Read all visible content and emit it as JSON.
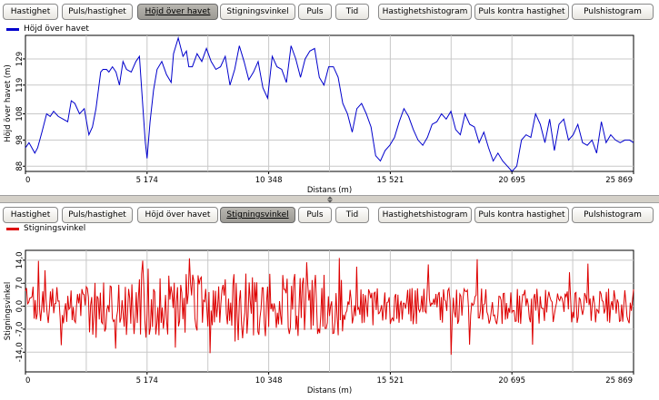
{
  "tabs": [
    {
      "id": "hastighet",
      "label": "Hastighet"
    },
    {
      "id": "puls-hastighet",
      "label": "Puls/hastighet"
    },
    {
      "id": "hojd",
      "label": "Höjd över havet"
    },
    {
      "id": "stigningsvinkel",
      "label": "Stigningsvinkel"
    },
    {
      "id": "puls",
      "label": "Puls"
    },
    {
      "id": "tid",
      "label": "Tid"
    },
    {
      "id": "hastighetshistogram",
      "label": "Hastighetshistogram"
    },
    {
      "id": "puls-kontra-hastighet",
      "label": "Puls kontra hastighet"
    },
    {
      "id": "pulshistogram",
      "label": "Pulshistogram"
    }
  ],
  "top_panel": {
    "active_tab": "hojd",
    "legend_label": "Höjd över havet",
    "line_color": "#0000cc"
  },
  "bottom_panel": {
    "active_tab": "stigningsvinkel",
    "legend_label": "Stigningsvinkel",
    "line_color": "#dd0000"
  },
  "chart_data": [
    {
      "type": "line",
      "title": "",
      "series_name": "Höjd över havet",
      "xlabel": "Distans (m)",
      "ylabel": "Höjd över havet (m)",
      "xlim": [
        0,
        25869
      ],
      "ylim": [
        86,
        138
      ],
      "x_ticks": [
        0,
        5174,
        10348,
        15521,
        20695,
        25869
      ],
      "x_tick_labels": [
        "0",
        "5 174",
        "10 348",
        "15 521",
        "20 695",
        "25 869"
      ],
      "y_ticks": [
        88,
        98,
        108,
        119,
        129
      ],
      "y_tick_labels": [
        "88",
        "98",
        "108",
        "119",
        "129"
      ],
      "grid": true,
      "legend": "top-left",
      "color": "#0000cc",
      "x": [
        0,
        150,
        400,
        520,
        700,
        900,
        1050,
        1200,
        1400,
        1600,
        1800,
        1950,
        2100,
        2300,
        2500,
        2700,
        2850,
        3000,
        3200,
        3300,
        3450,
        3550,
        3700,
        3850,
        4000,
        4150,
        4300,
        4500,
        4700,
        4850,
        5000,
        5100,
        5174,
        5300,
        5450,
        5600,
        5800,
        6000,
        6200,
        6300,
        6500,
        6700,
        6850,
        6950,
        7100,
        7300,
        7500,
        7700,
        7900,
        8100,
        8300,
        8500,
        8700,
        8900,
        9100,
        9300,
        9500,
        9700,
        9900,
        10100,
        10300,
        10500,
        10700,
        10900,
        11100,
        11300,
        11500,
        11700,
        11900,
        12100,
        12300,
        12500,
        12700,
        12900,
        13100,
        13300,
        13500,
        13700,
        13900,
        14100,
        14300,
        14500,
        14700,
        14900,
        15100,
        15300,
        15500,
        15700,
        15900,
        16100,
        16300,
        16500,
        16700,
        16900,
        17100,
        17300,
        17500,
        17700,
        17900,
        18100,
        18300,
        18500,
        18700,
        18900,
        19100,
        19300,
        19500,
        19700,
        19900,
        20100,
        20300,
        20500,
        20700,
        20900,
        21100,
        21300,
        21500,
        21700,
        21900,
        22100,
        22300,
        22500,
        22700,
        22900,
        23100,
        23300,
        23500,
        23700,
        23900,
        24100,
        24300,
        24500,
        24700,
        24900,
        25100,
        25300,
        25500,
        25700,
        25869
      ],
      "y": [
        95,
        97,
        93,
        95,
        101,
        108,
        107,
        109,
        107,
        106,
        105,
        113,
        112,
        108,
        110,
        100,
        103,
        110,
        124,
        125,
        125,
        124,
        126,
        124,
        119,
        128,
        125,
        124,
        128,
        130,
        110,
        97,
        91,
        105,
        117,
        125,
        128,
        123,
        120,
        131,
        137,
        130,
        132,
        126,
        126,
        131,
        128,
        133,
        128,
        125,
        126,
        130,
        119,
        125,
        134,
        128,
        121,
        124,
        128,
        118,
        114,
        130,
        126,
        125,
        120,
        134,
        129,
        122,
        129,
        132,
        133,
        122,
        119,
        126,
        126,
        122,
        112,
        108,
        101,
        110,
        112,
        108,
        103,
        92,
        90,
        94,
        96,
        99,
        105,
        110,
        107,
        102,
        98,
        96,
        99,
        104,
        105,
        108,
        106,
        109,
        102,
        100,
        108,
        104,
        103,
        97,
        101,
        95,
        90,
        93,
        90,
        88,
        86,
        88,
        98,
        100,
        99,
        108,
        104,
        97,
        106,
        94,
        104,
        106,
        98,
        100,
        104,
        97,
        96,
        98,
        93,
        105,
        97,
        100,
        98,
        97,
        98,
        98,
        97
      ]
    },
    {
      "type": "line",
      "title": "",
      "series_name": "Stigningsvinkel",
      "xlabel": "Distans (m)",
      "ylabel": "Stigningsvinkel",
      "xlim": [
        0,
        25869
      ],
      "ylim": [
        -20,
        17
      ],
      "x_ticks": [
        0,
        5174,
        10348,
        15521,
        20695,
        25869
      ],
      "x_tick_labels": [
        "0",
        "5 174",
        "10 348",
        "15 521",
        "20 695",
        "25 869"
      ],
      "y_ticks": [
        -14.0,
        -7.0,
        0.0,
        7.0,
        14.0
      ],
      "y_tick_labels": [
        "-14,0",
        "-7,0",
        "0,0",
        "7,0",
        "14,0"
      ],
      "grid": true,
      "legend": "top-left",
      "color": "#dd0000"
    }
  ]
}
